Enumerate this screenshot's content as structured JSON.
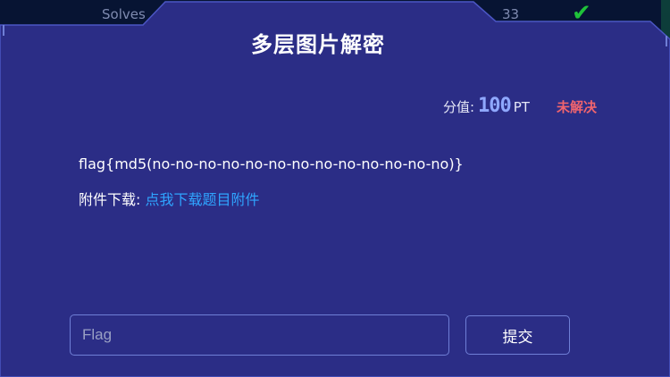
{
  "background": {
    "solves_label": "Solves",
    "count": "33",
    "check_icon": "check-icon"
  },
  "challenge": {
    "title": "多层图片解密",
    "score_label": "分值:",
    "score_value": "100",
    "score_unit": "PT",
    "status": "未解决",
    "description": "flag{md5(no-no-no-no-no-no-no-no-no-no-no-no-no)}",
    "attachment_label": "附件下载:",
    "attachment_link": "点我下载题目附件"
  },
  "form": {
    "flag_placeholder": "Flag",
    "submit_label": "提交"
  },
  "colors": {
    "panel": "#2b2d86",
    "panel_border": "#4b56c4",
    "link": "#2fa5ff",
    "score": "#8fa8ff",
    "status_unsolved": "#f0646e"
  }
}
